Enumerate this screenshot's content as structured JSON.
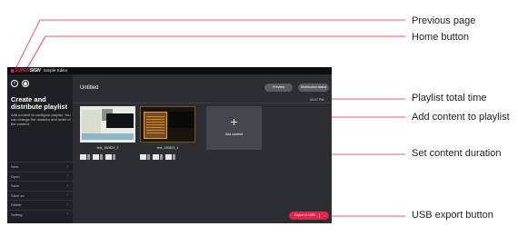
{
  "app": {
    "brand_red": "SUPER",
    "brand_white": "SIGN",
    "app_name": "Simple Editor",
    "accent_color": "#e8214b"
  },
  "sidebar": {
    "prev_icon": "chevron-left-icon",
    "home_icon": "home-icon",
    "title": "Create and distribute playlist",
    "description": "Add content to configure playlist. You can change the duration and order of the content.",
    "menu": [
      {
        "label": "New"
      },
      {
        "label": "Open"
      },
      {
        "label": "Save"
      },
      {
        "label": "Save as"
      },
      {
        "label": "Delete"
      },
      {
        "label": "Setting"
      }
    ]
  },
  "main": {
    "playlist_title": "Untitled",
    "preview_label": "Preview",
    "distribution_label": "Distribution status",
    "total_time": "00:07 PM",
    "add_content_label": "Add content",
    "items": [
      {
        "file_name": "test_150824_2"
      },
      {
        "file_name": "test_150823_1"
      }
    ],
    "usb_export_label": "Export to USB"
  },
  "callouts": {
    "previous_page": "Previous page",
    "home_button": "Home button",
    "playlist_total_time": "Playlist total time",
    "add_content": "Add content to playlist",
    "set_duration": "Set content duration",
    "usb_export": "USB export button"
  }
}
